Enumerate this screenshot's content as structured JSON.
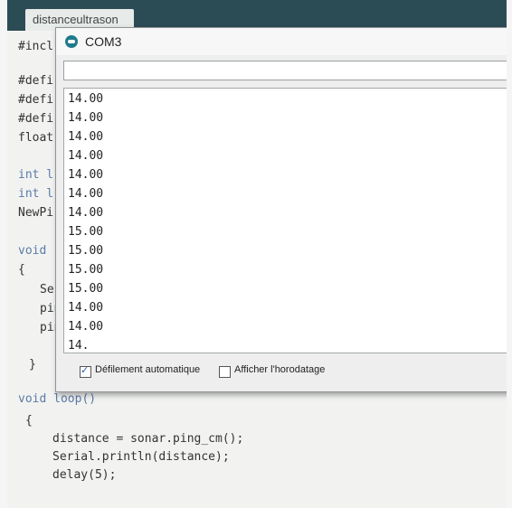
{
  "ide": {
    "tab_label": "distanceultrason",
    "code_lines": [
      "#incl",
      "#defi",
      "#defi",
      "#defi",
      "float",
      "int l",
      "int l",
      "NewPi",
      "void",
      "{",
      "Ser",
      "pin",
      "pin",
      "}"
    ],
    "loop_lines": [
      "void loop()",
      "{",
      "distance = sonar.ping_cm();",
      "Serial.println(distance);",
      "delay(5);"
    ]
  },
  "serial_monitor": {
    "title": "COM3",
    "send_value": "",
    "output_lines": [
      "14.00",
      "14.00",
      "14.00",
      "14.00",
      "14.00",
      "14.00",
      "14.00",
      "15.00",
      "15.00",
      "15.00",
      "15.00",
      "14.00",
      "14.00",
      "14."
    ],
    "autoscroll_label": "Défilement automatique",
    "autoscroll_checked": true,
    "timestamp_label": "Afficher l'horodatage",
    "timestamp_checked": false
  },
  "colors": {
    "top_band": "#2c4c55",
    "icon": "#1f7a8c"
  }
}
